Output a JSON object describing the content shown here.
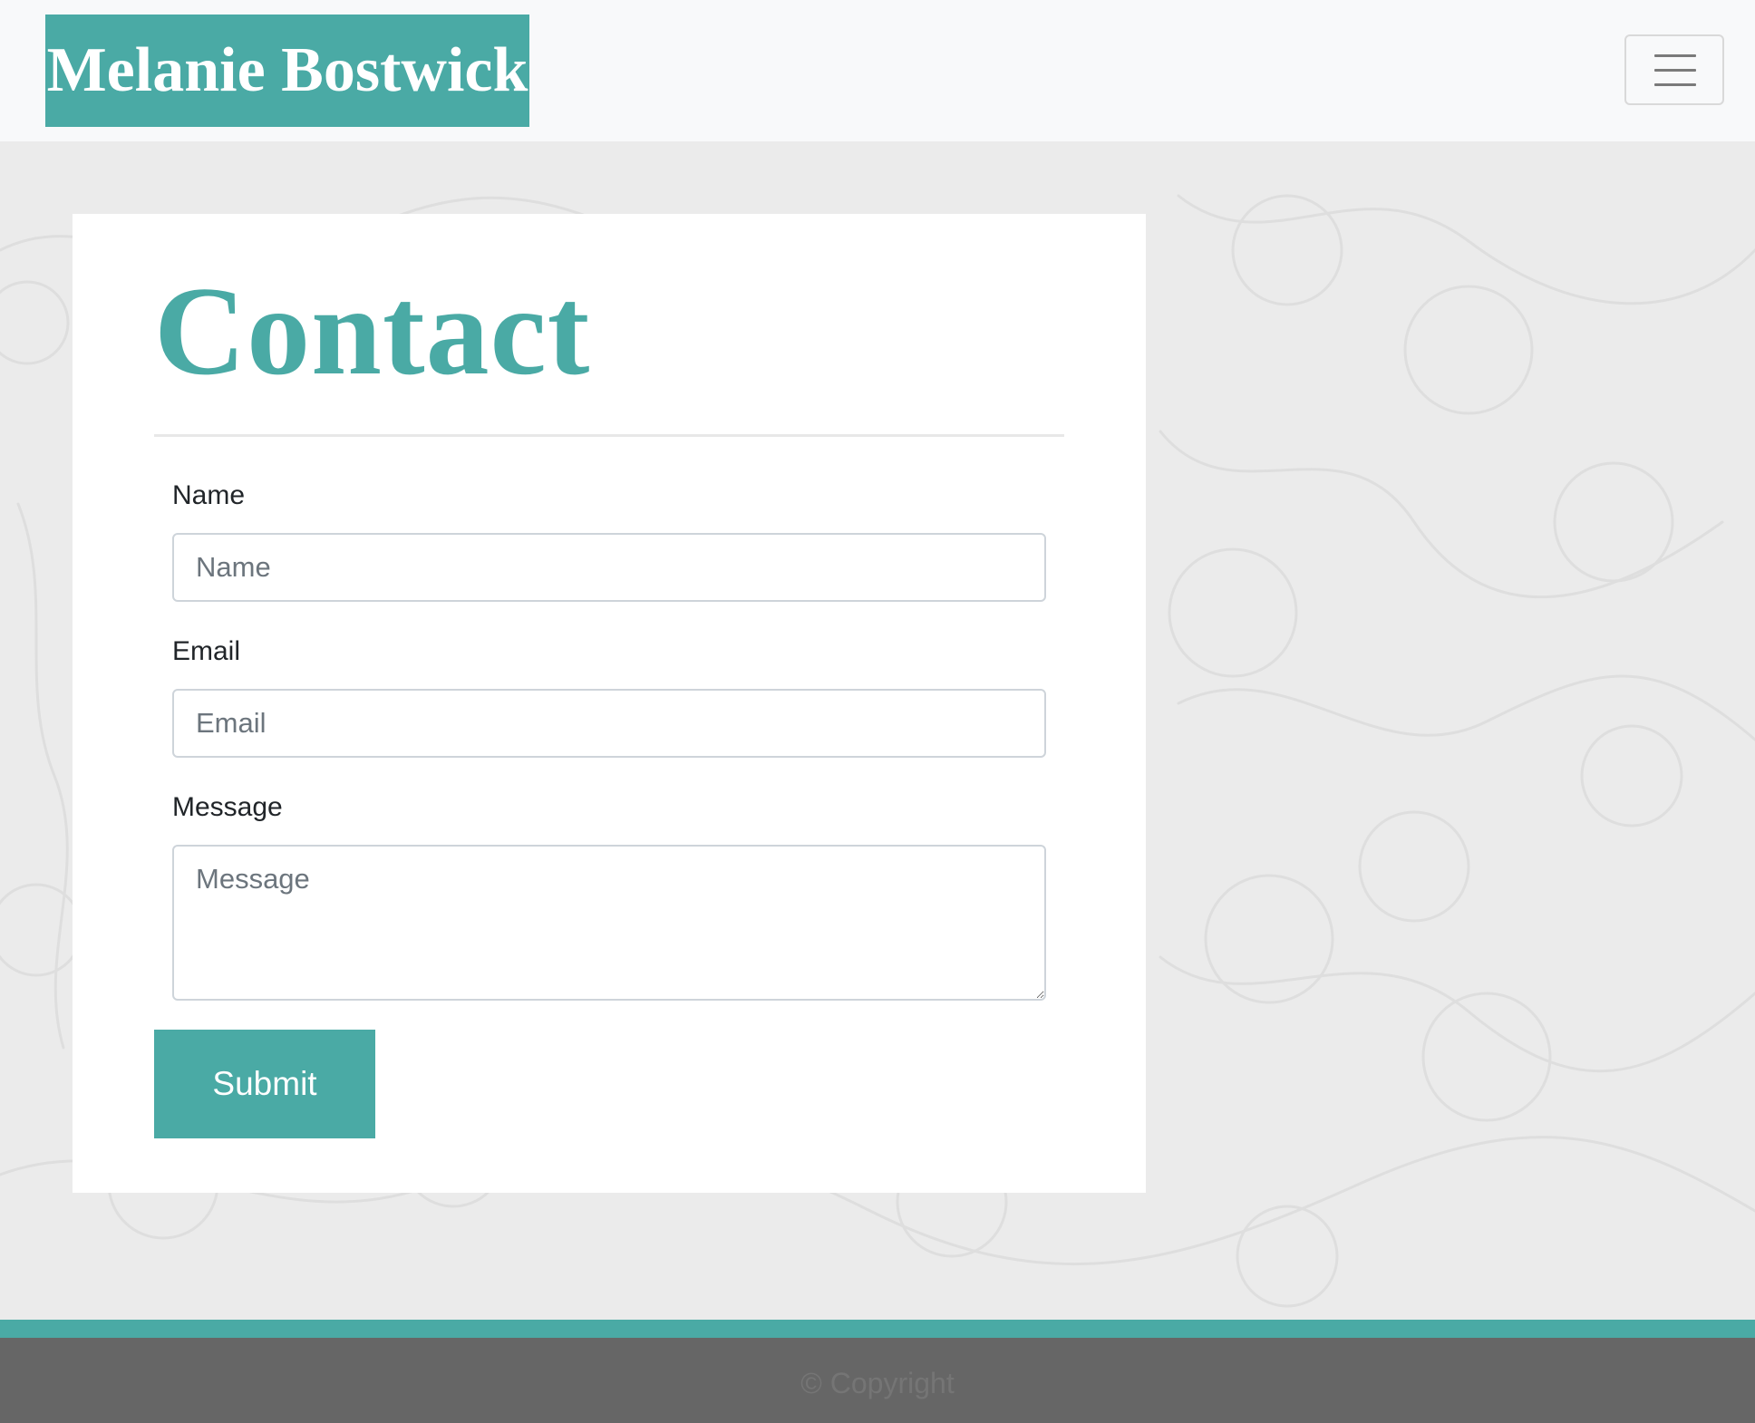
{
  "navbar": {
    "brand": "Melanie Bostwick",
    "toggler_icon": "hamburger-menu-icon"
  },
  "contact": {
    "title": "Contact",
    "name_label": "Name",
    "name_placeholder": "Name",
    "email_label": "Email",
    "email_placeholder": "Email",
    "message_label": "Message",
    "message_placeholder": "Message",
    "submit_label": "Submit"
  },
  "footer": {
    "copyright": "© Copyright"
  },
  "colors": {
    "accent": "#4aaaa5",
    "navbar_bg": "#f8f9fa",
    "page_bg": "#ebebeb",
    "footer_bg": "#666666"
  }
}
